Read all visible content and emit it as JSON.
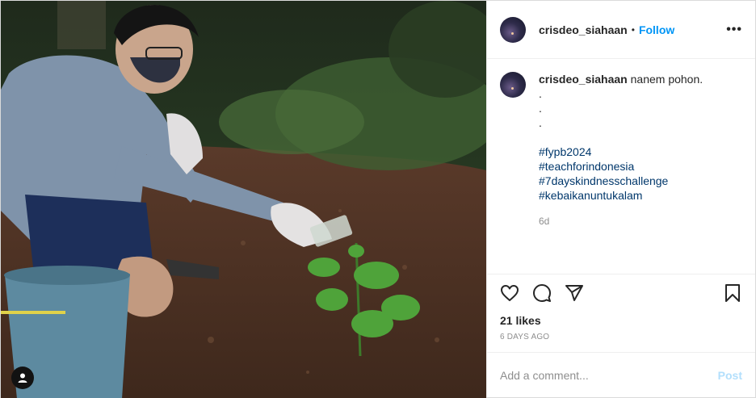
{
  "post": {
    "username": "crisdeo_siahaan",
    "follow_label": "Follow",
    "separator": "•",
    "more_label": "•••",
    "caption": {
      "username": "crisdeo_siahaan",
      "text": "nanem pohon.",
      "dots": [
        ".",
        ".",
        "."
      ],
      "hashtags": [
        "#fypb2024",
        "#teachforindonesia",
        "#7dayskindnesschallenge",
        "#kebaikanuntukalam"
      ]
    },
    "age": "6d",
    "likes": "21 likes",
    "time_ago": "6 DAYS AGO",
    "comment_placeholder": "Add a comment...",
    "post_label": "Post"
  },
  "icons": {
    "like": "heart-icon",
    "comment": "comment-icon",
    "share": "paper-plane-icon",
    "save": "bookmark-icon",
    "tags": "user-tag-icon"
  }
}
